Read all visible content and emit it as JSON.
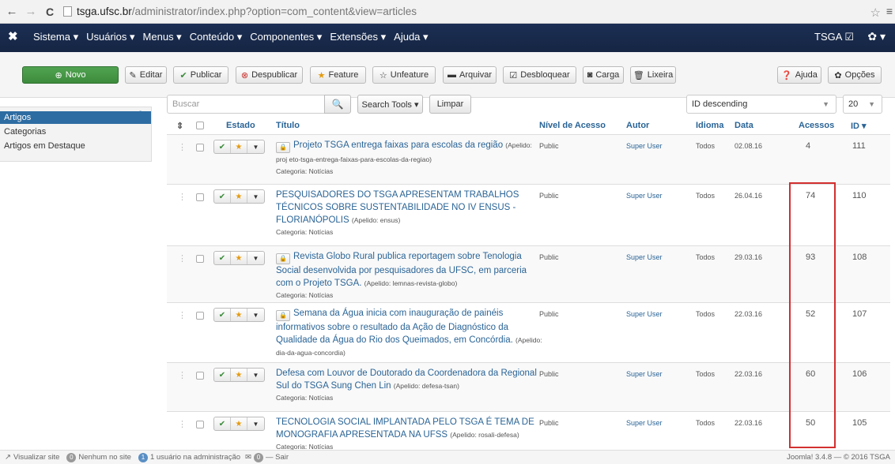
{
  "browser": {
    "url_host": "tsga.ufsc.br",
    "url_path": "/administrator/index.php?option=com_content&view=articles"
  },
  "navbar": {
    "items": [
      "Sistema ▾",
      "Usuários ▾",
      "Menus ▾",
      "Conteúdo ▾",
      "Componentes ▾",
      "Extensões ▾",
      "Ajuda ▾"
    ],
    "user": "TSGA ☑",
    "gear": "✿ ▾"
  },
  "toolbar": {
    "new": "Novo",
    "edit": "Editar",
    "publish": "Publicar",
    "unpublish": "Despublicar",
    "feature": "Feature",
    "unfeature": "Unfeature",
    "archive": "Arquivar",
    "unlock": "Desbloquear",
    "batch": "Carga",
    "trash": "Lixeira",
    "help": "Ajuda",
    "options": "Opções"
  },
  "sidebar": {
    "items": [
      "Artigos",
      "Categorias",
      "Artigos em Destaque"
    ]
  },
  "filters": {
    "search_placeholder": "Buscar",
    "search_tools": "Search Tools ▾",
    "clear": "Limpar",
    "sort": "ID descending",
    "limit": "20"
  },
  "table": {
    "headers": {
      "status": "Estado",
      "title": "Título",
      "access": "Nível de Acesso",
      "author": "Autor",
      "language": "Idioma",
      "date": "Data",
      "hits": "Acessos",
      "id": "ID ▾"
    },
    "rows": [
      {
        "title": "Projeto TSGA entrega faixas para escolas da região",
        "alias": "(Apelido: proj eto-tsga-entrega-faixas-para-escolas-da-regiao)",
        "category": "Categoria: Notícias",
        "access": "Public",
        "author": "Super User",
        "language": "Todos",
        "date": "02.08.16",
        "hits": "4",
        "id": "111"
      },
      {
        "title": "PESQUISADORES DO TSGA APRESENTAM TRABALHOS TÉCNICOS SOBRE SUSTENTABILIDADE NO IV ENSUS - FLORIANÓPOLIS",
        "alias": "(Apelido: ensus)",
        "category": "Categoria: Notícias",
        "access": "Public",
        "author": "Super User",
        "language": "Todos",
        "date": "26.04.16",
        "hits": "74",
        "id": "110"
      },
      {
        "title": "Revista Globo Rural publica reportagem sobre Tenologia Social desenvolvida por pesquisadores da UFSC, em parceria com o Projeto TSGA.",
        "alias": "(Apelido: lemnas-revista-globo)",
        "category": "Categoria: Notícias",
        "access": "Public",
        "author": "Super User",
        "language": "Todos",
        "date": "29.03.16",
        "hits": "93",
        "id": "108"
      },
      {
        "title": "Semana da Água inicia com inauguração de painéis informativos sobre o resultado da Ação de Diagnóstico da Qualidade da Água do Rio dos Queimados, em Concórdia.",
        "alias": "(Apelido: dia-da-agua-concordia)",
        "category": "Categoria: Notícias",
        "access": "Public",
        "author": "Super User",
        "language": "Todos",
        "date": "22.03.16",
        "hits": "52",
        "id": "107"
      },
      {
        "title": "Defesa com Louvor de Doutorado da Coordenadora da Regional Sul do TSGA Sung Chen Lin",
        "alias": "(Apelido: defesa-tsan)",
        "category": "Categoria: Notícias",
        "access": "Public",
        "author": "Super User",
        "language": "Todos",
        "date": "22.03.16",
        "hits": "60",
        "id": "106"
      },
      {
        "title": "TECNOLOGIA SOCIAL IMPLANTADA PELO TSGA É TEMA DE MONOGRAFIA APRESENTADA NA UFSS",
        "alias": "(Apelido: rosali-defesa)",
        "category": "Categoria: Notícias",
        "access": "Public",
        "author": "Super User",
        "language": "Todos",
        "date": "22.03.16",
        "hits": "50",
        "id": "105"
      }
    ]
  },
  "statusbar": {
    "view_site": "Visualizar site",
    "no_site_count": "0",
    "no_site_text": "Nenhum no site",
    "admin_count": "1",
    "admin_text": "1 usuário na administração",
    "msg_count": "0",
    "logout": "— Sair",
    "version": "Joomla! 3.4.8 — © 2016 TSGA"
  },
  "colors": {
    "navbar": "#1c2f54",
    "link": "#2a6496",
    "new_button": "#51a351",
    "highlight": "#d32f2f"
  }
}
